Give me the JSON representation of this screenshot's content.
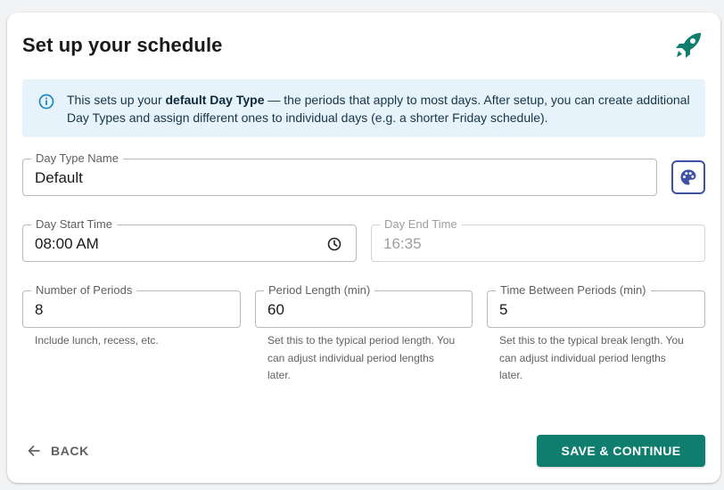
{
  "header": {
    "title": "Set up your schedule",
    "icon": "rocket-icon"
  },
  "info": {
    "icon": "info-icon",
    "text_before": "This sets up your ",
    "text_bold": "default Day Type",
    "text_after": " — the periods that apply to most days. After setup, you can create additional Day Types and assign different ones to individual days (e.g. a shorter Friday schedule)."
  },
  "day_type": {
    "label": "Day Type Name",
    "value": "Default",
    "palette_icon": "palette-icon"
  },
  "start_time": {
    "label": "Day Start Time",
    "value": "08:00 AM",
    "icon": "clock-icon"
  },
  "end_time": {
    "label": "Day End Time",
    "value": "16:35"
  },
  "periods": {
    "label": "Number of Periods",
    "value": "8",
    "help": "Include lunch, recess, etc."
  },
  "period_length": {
    "label": "Period Length (min)",
    "value": "60",
    "help": "Set this to the typical period length. You can adjust individual period lengths later."
  },
  "between": {
    "label": "Time Between Periods (min)",
    "value": "5",
    "help": "Set this to the typical break length. You can adjust individual period lengths later."
  },
  "footer": {
    "back_label": "BACK",
    "back_icon": "arrow-left-icon",
    "save_label": "SAVE & CONTINUE"
  },
  "colors": {
    "accent": "#0f7e6e",
    "info_bg": "#e6f3fb",
    "info_icon": "#1e88c7",
    "palette_border": "#3f51a5"
  }
}
